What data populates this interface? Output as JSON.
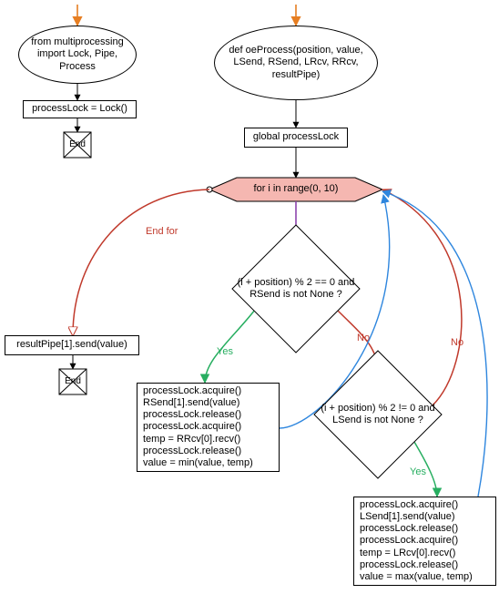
{
  "left_flow": {
    "start": "from multiprocessing import Lock, Pipe, Process",
    "init": "processLock = Lock()",
    "end": "End"
  },
  "right_flow": {
    "func_def": "def oeProcess(position, value, LSend, RSend, LRcv, RRcv, resultPipe)",
    "global": "global processLock",
    "loop": "for i in range(0, 10)",
    "end_for_label": "End for",
    "result_send": "resultPipe[1].send(value)",
    "end": "End",
    "cond1": "(i + position) % 2 == 0 and RSend is not None ?",
    "cond2": "(i + position) % 2 != 0 and LSend is not None ?",
    "block_right": "processLock.acquire()\nRSend[1].send(value)\nprocessLock.release()\nprocessLock.acquire()\ntemp = RRcv[0].recv()\nprocessLock.release()\nvalue = min(value, temp)",
    "block_left": "processLock.acquire()\nLSend[1].send(value)\nprocessLock.release()\nprocessLock.acquire()\ntemp = LRcv[0].recv()\nprocessLock.release()\nvalue = max(value, temp)"
  },
  "labels": {
    "yes": "Yes",
    "no": "No"
  },
  "colors": {
    "hex_fill": "#f5b7b1",
    "arrow_black": "#000000",
    "arrow_red": "#c0392b",
    "arrow_green": "#27ae60",
    "arrow_purple": "#8e44ad",
    "arrow_orange": "#e67e22",
    "arrow_blue": "#2e86de"
  }
}
